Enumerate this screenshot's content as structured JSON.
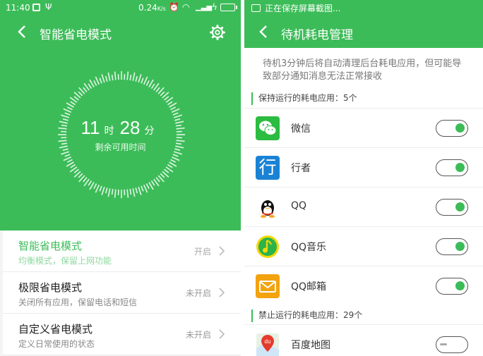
{
  "left": {
    "status": {
      "time": "11:40",
      "speed": "0.24",
      "speed_unit": "K/s"
    },
    "header": {
      "title": "智能省电模式"
    },
    "remaining": {
      "hours": "11",
      "hours_unit": "时",
      "minutes": "28",
      "minutes_unit": "分",
      "label": "剩余可用时间"
    },
    "modes": [
      {
        "title": "智能省电模式",
        "desc": "均衡模式，保留上网功能",
        "state": "开启",
        "active": true
      },
      {
        "title": "极限省电模式",
        "desc": "关闭所有应用，保留电话和短信",
        "state": "未开启",
        "active": false
      },
      {
        "title": "自定义省电模式",
        "desc": "定义日常使用的状态",
        "state": "未开启",
        "active": false
      }
    ],
    "colors": {
      "accent": "#3cbc58"
    }
  },
  "right": {
    "status": {
      "notice": "正在保存屏幕截图..."
    },
    "header": {
      "title": "待机耗电管理"
    },
    "note": "待机3分钟后将自动清理后台耗电应用，但可能导致部分通知消息无法正常接收",
    "keep_section": "保持运行的耗电应用：5个",
    "keep_apps": [
      {
        "name": "微信",
        "icon": "wechat-icon",
        "enabled": true
      },
      {
        "name": "行者",
        "icon": "xingzhe-icon",
        "icon_char": "行",
        "enabled": true
      },
      {
        "name": "QQ",
        "icon": "qq-icon",
        "enabled": true
      },
      {
        "name": "QQ音乐",
        "icon": "qq-music-icon",
        "enabled": true
      },
      {
        "name": "QQ邮箱",
        "icon": "qq-mail-icon",
        "enabled": true
      }
    ],
    "ban_section": "禁止运行的耗电应用：29个",
    "ban_apps": [
      {
        "name": "百度地图",
        "icon": "baidu-map-icon",
        "icon_char": "du",
        "enabled": false
      }
    ]
  }
}
